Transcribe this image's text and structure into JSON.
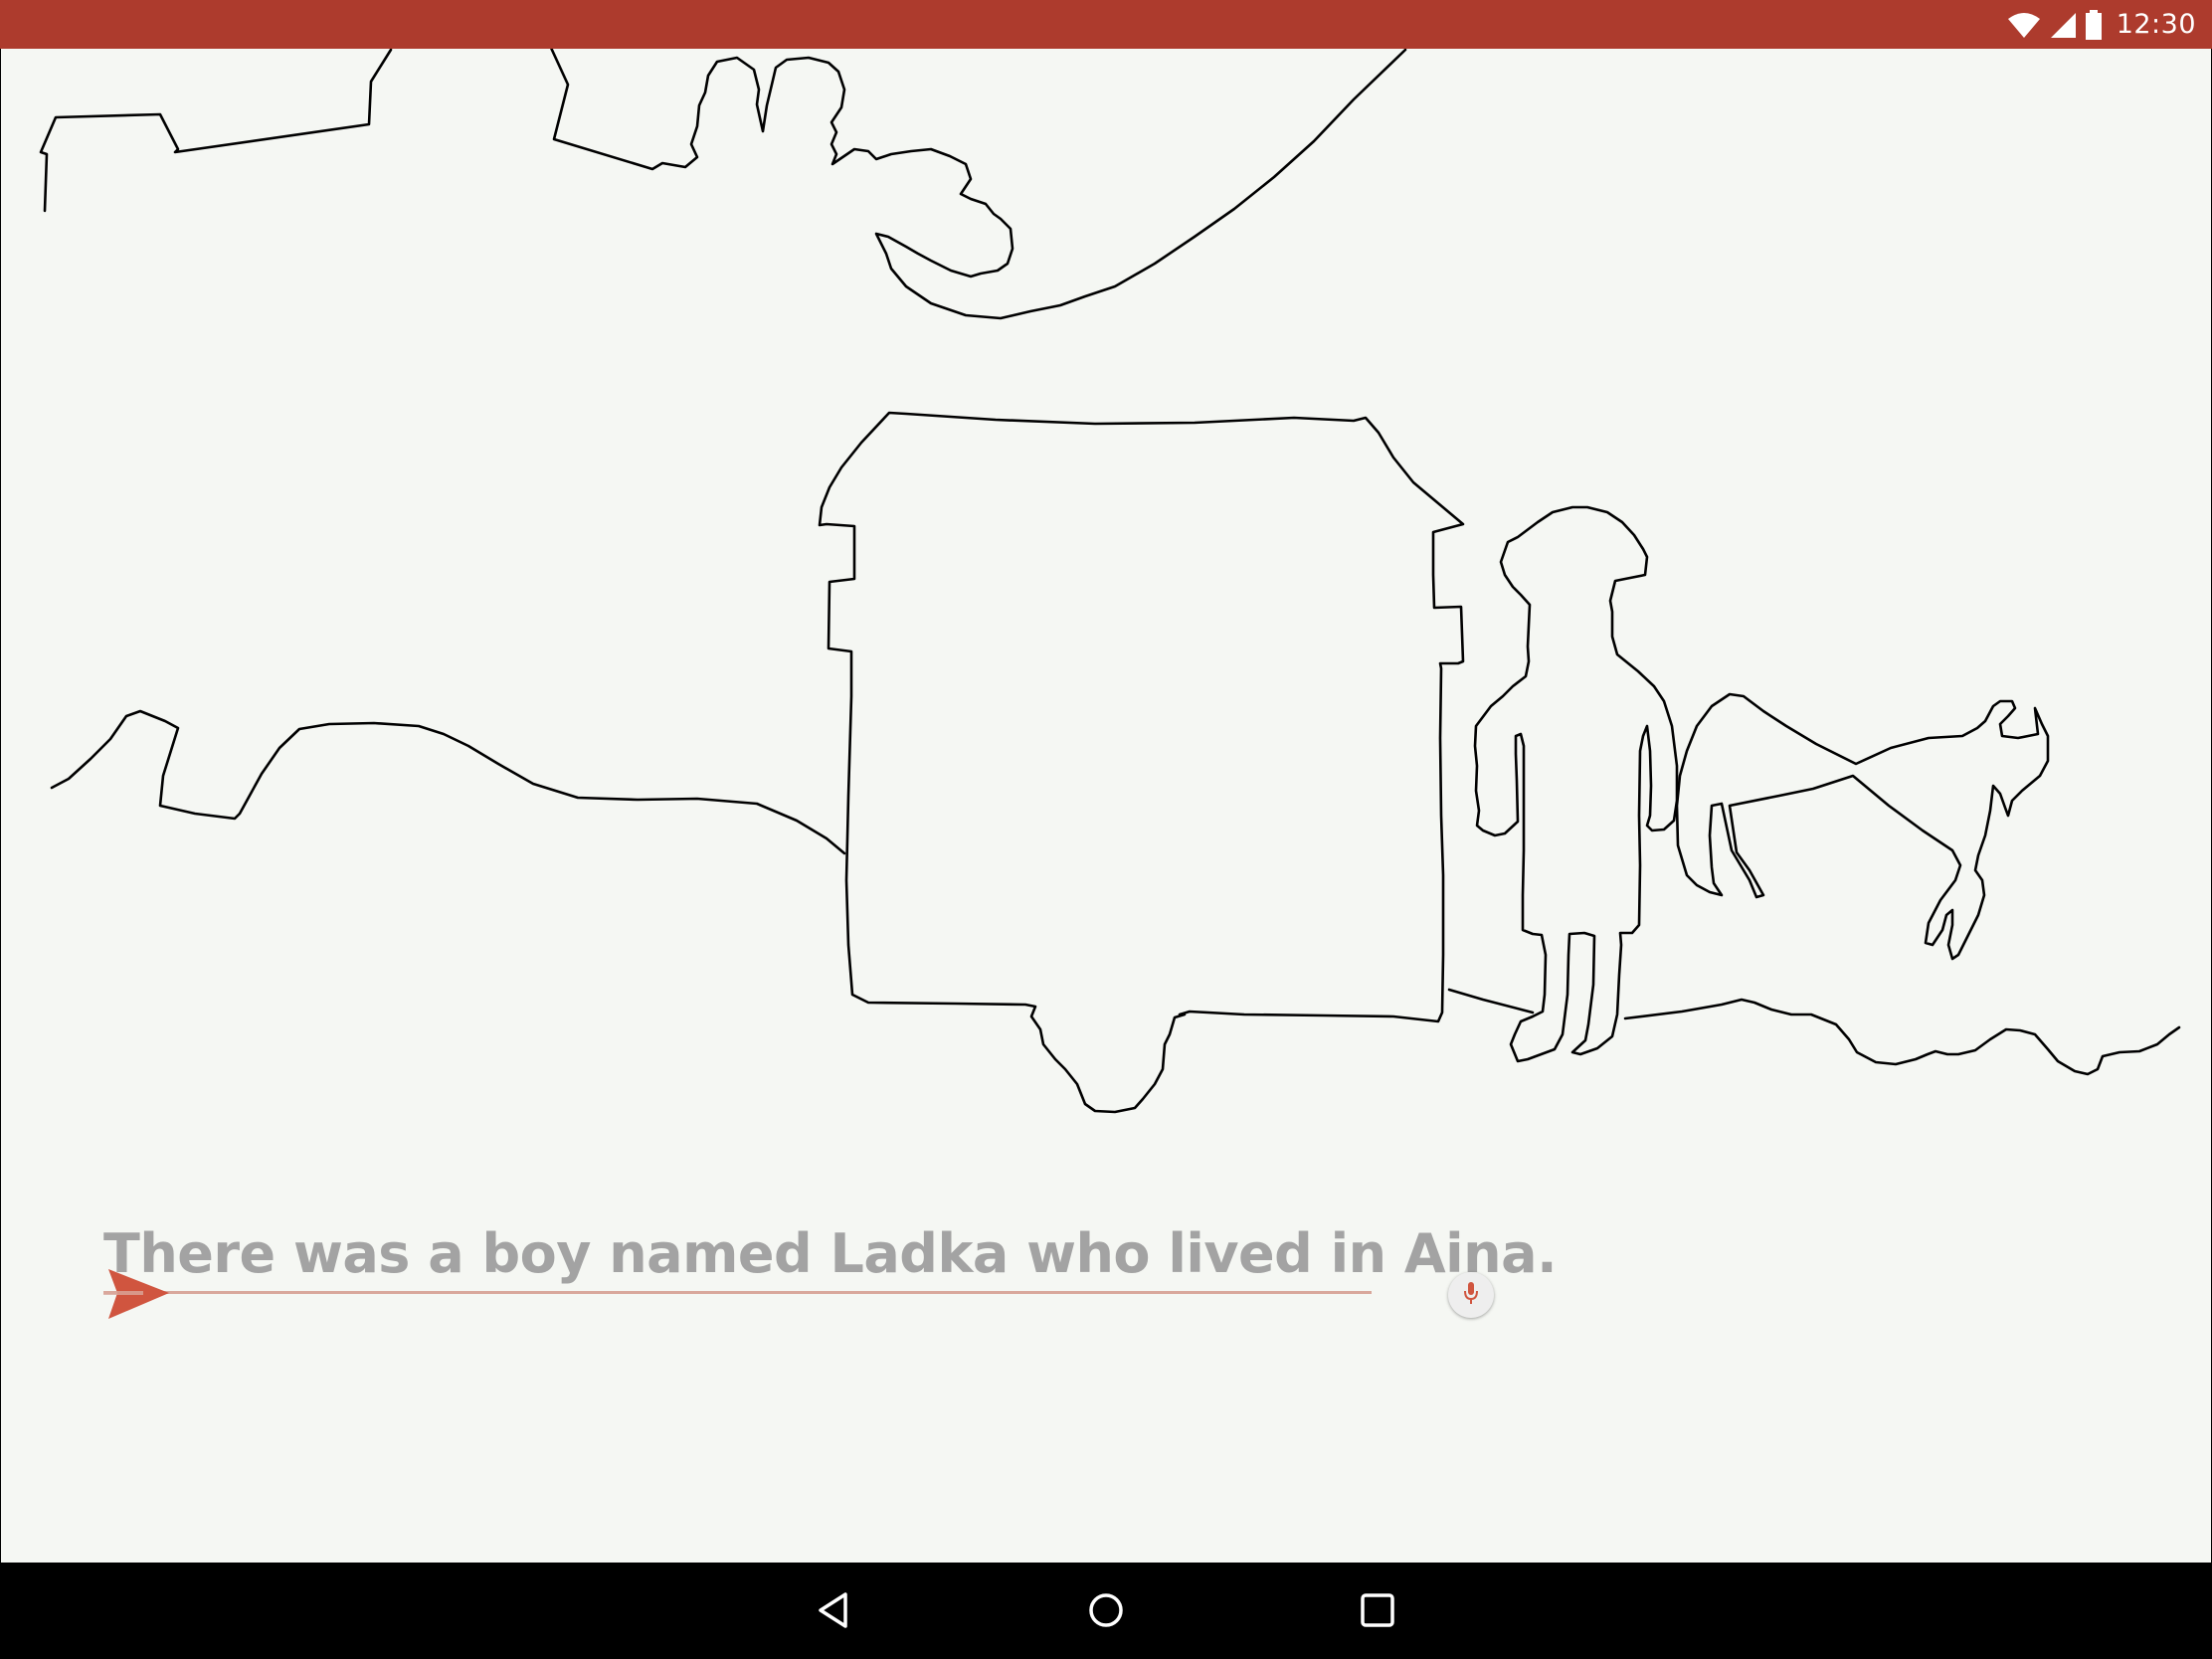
{
  "status_bar": {
    "time": "12:30",
    "icons": [
      "wifi-icon",
      "cell-signal-icon",
      "battery-icon"
    ]
  },
  "story": {
    "sentence": "There was a boy named Ladka who lived in Aina."
  },
  "navigation": {
    "buttons": [
      "back-icon",
      "home-icon",
      "recents-icon"
    ]
  },
  "colors": {
    "status_bar": "#ad3b2d",
    "canvas": "#f5f7f3",
    "accent": "#d0553f",
    "text": "#a3a3a3"
  }
}
